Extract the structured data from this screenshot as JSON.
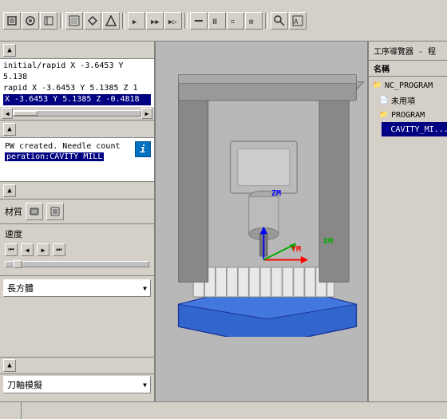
{
  "toolbar": {
    "buttons": [
      "▶",
      "⏹",
      "⏺",
      "📄",
      "📂",
      "💾",
      "✂",
      "📋",
      "📌",
      "↩",
      "↪",
      "🔍",
      "🔎",
      "⚙",
      "🔧",
      "🔩",
      "📐",
      "📏"
    ]
  },
  "left_panel": {
    "code_lines": [
      "initial/rapid X -3.6453 Y 5.138",
      "rapid X -3.6453 Y 5.1385 Z 1",
      " X -3.6453 Y 5.1385 Z -0.4818"
    ],
    "messages": [
      "PW created. Needle count",
      "peration:CAVITY MILL"
    ],
    "label_material": "材質",
    "label_speed": "速度",
    "dropdown_label": "長方體",
    "bottom_label": "刀軸模擬"
  },
  "right_panel": {
    "title": "工序導覽器 - 程",
    "col_header": "名稱",
    "tree": [
      {
        "id": "nc_program",
        "label": "NC_PROGRAM",
        "level": 0,
        "type": "root"
      },
      {
        "id": "unused",
        "label": "未用項",
        "level": 1,
        "type": "folder"
      },
      {
        "id": "program",
        "label": "PROGRAM",
        "level": 1,
        "type": "folder"
      },
      {
        "id": "cavity_mill",
        "label": "CAVITY_MI...",
        "level": 2,
        "type": "mill",
        "selected": true
      }
    ]
  },
  "viewport": {
    "axes": {
      "x": "XM",
      "y": "YM",
      "z": "ZM"
    }
  },
  "status_bar": {
    "items": []
  }
}
